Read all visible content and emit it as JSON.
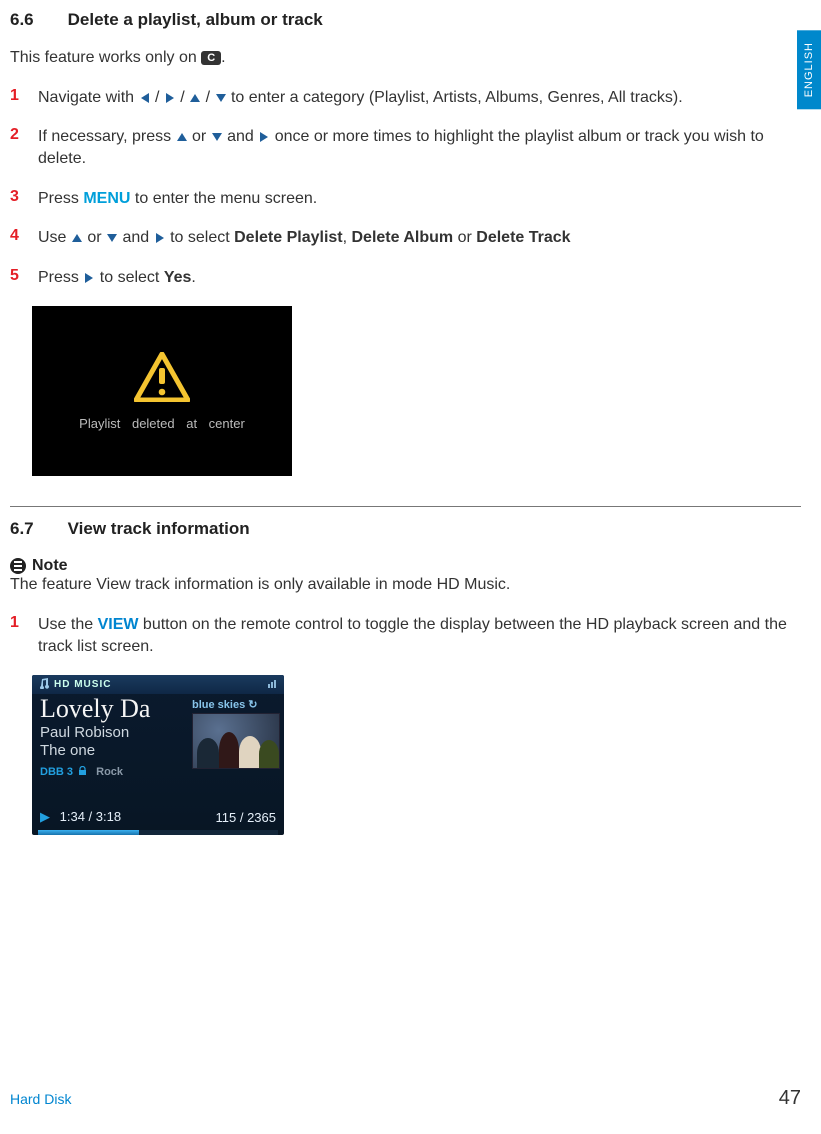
{
  "lang_tab": "ENGLISH",
  "section66": {
    "number": "6.6",
    "title": "Delete a playlist, album or track",
    "intro_pre": "This feature works only on ",
    "c_label": "C",
    "intro_post": "."
  },
  "steps66": [
    {
      "num": "1",
      "pre": "Navigate with ",
      "post": " to enter a category (Playlist,  Artists,  Albums, Genres,  All tracks)."
    },
    {
      "num": "2",
      "pre": "If necessary, press ",
      "mid": " and ",
      "post": " once or more times to highlight the playlist album or track you wish to delete."
    },
    {
      "num": "3",
      "pre": "Press ",
      "menu": "MENU",
      "post": " to enter the menu screen."
    },
    {
      "num": "4",
      "pre": "Use ",
      "or": " or ",
      "and": " and ",
      "post_pre": " to select ",
      "opt1": "Delete Playlist",
      "comma": ", ",
      "opt2": "Delete Album",
      "or2": " or ",
      "opt3": "Delete Track"
    },
    {
      "num": "5",
      "pre": "Press ",
      "post_pre": " to select ",
      "yes": "Yes",
      "post": "."
    }
  ],
  "screenshot66": {
    "text": "Playlist deleted at center"
  },
  "section67": {
    "number": "6.7",
    "title": "View track information",
    "note_label": "Note",
    "note_text": "The feature View track information is only available in mode HD Music.",
    "steps": [
      {
        "num": "1",
        "pre": "Use the ",
        "view": "VIEW",
        "post": " button on the remote control to toggle the display between the HD playback screen and the track list screen."
      }
    ]
  },
  "hd": {
    "header_label": "HD MUSIC",
    "title": "Lovely Da",
    "artist": "Paul Robison",
    "album": "The one",
    "dbb": "DBB 3",
    "genre": "Rock",
    "right_label": "blue skies",
    "time": "1:34 / 3:18",
    "count": "115 / 2365"
  },
  "footer": {
    "left": "Hard Disk",
    "page": "47"
  }
}
